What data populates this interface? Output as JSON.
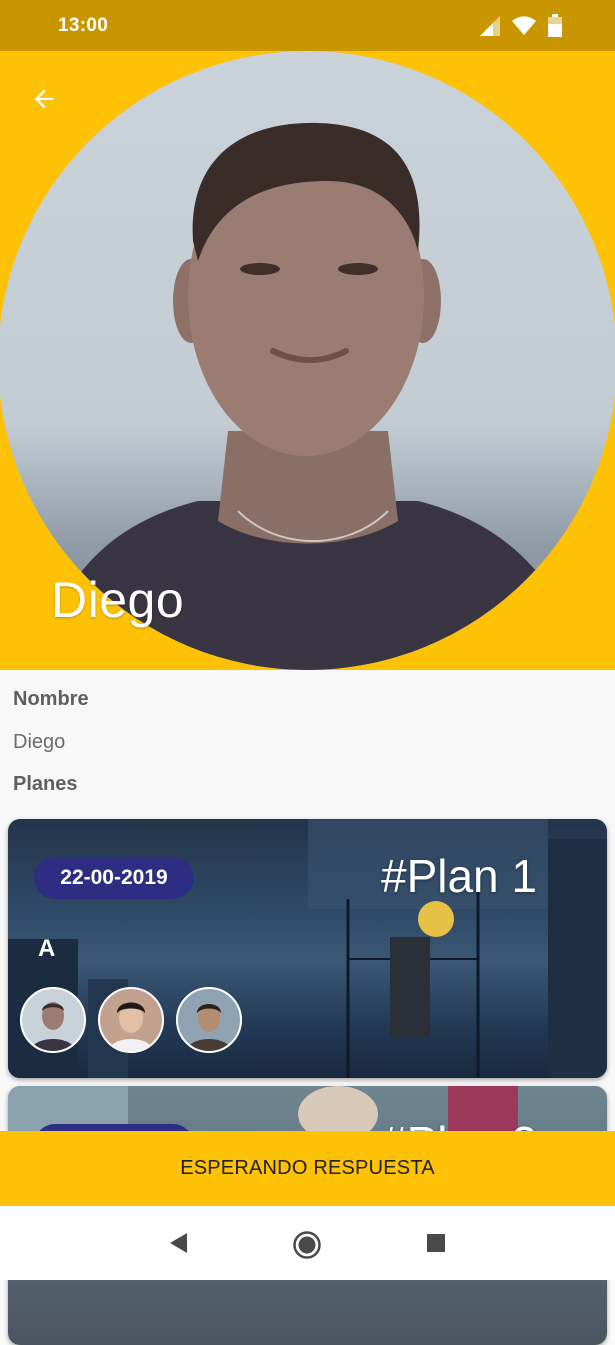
{
  "status_bar": {
    "time": "13:00"
  },
  "profile": {
    "name": "Diego"
  },
  "details": {
    "name_label": "Nombre",
    "name_value": "Diego",
    "plans_label": "Planes"
  },
  "plans": [
    {
      "date": "22-00-2019",
      "title": "#Plan 1",
      "letter": "A",
      "participants": 3
    },
    {
      "date": "",
      "title": "#Plan 2",
      "letter": "",
      "participants": 0
    }
  ],
  "action_button": {
    "label": "ESPERANDO RESPUESTA"
  },
  "icons": {
    "back": "arrow-back-icon",
    "signal": "signal-icon",
    "wifi": "wifi-icon",
    "battery": "battery-icon",
    "nav_back": "nav-back-icon",
    "nav_home": "nav-home-icon",
    "nav_recents": "nav-recents-icon"
  },
  "colors": {
    "accent": "#fdc106",
    "status_bar": "#c99600",
    "badge": "#2d2d84"
  }
}
